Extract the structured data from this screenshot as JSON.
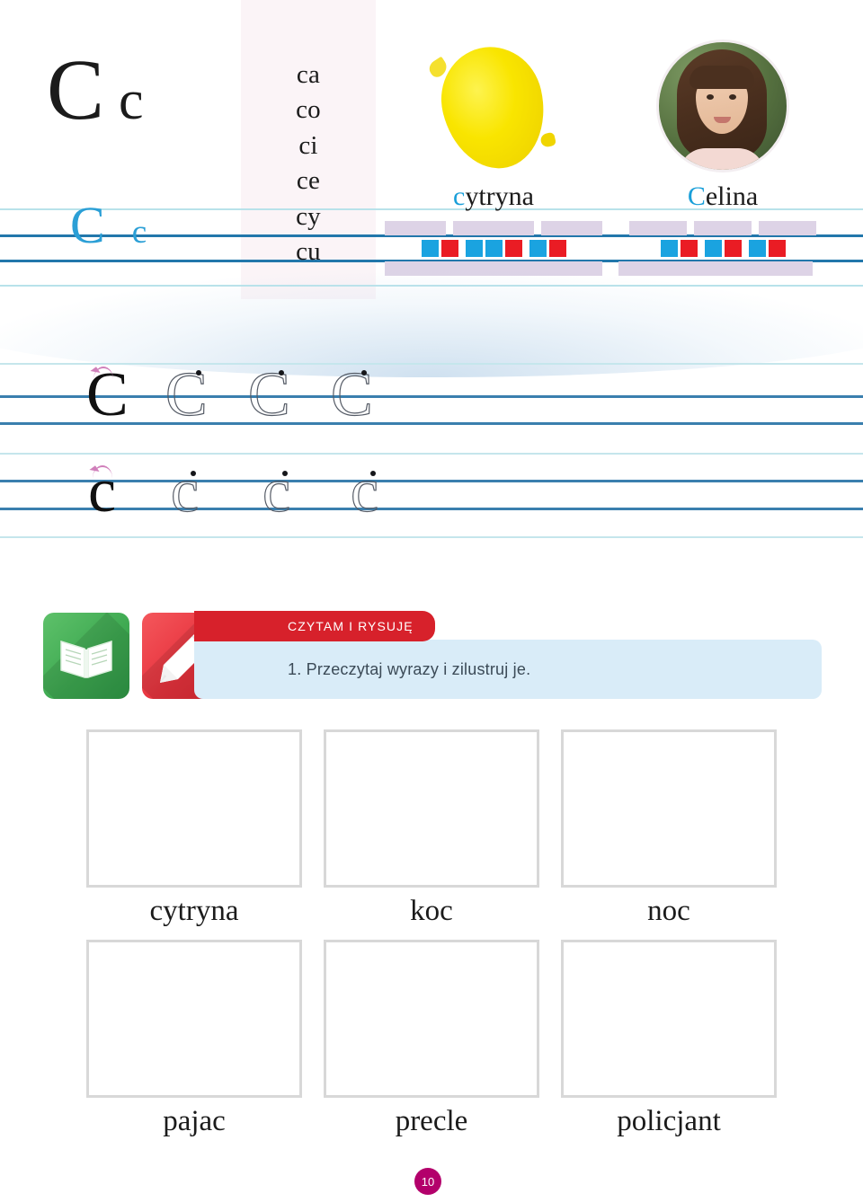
{
  "header": {
    "letter_upper": "C",
    "letter_lower": "c",
    "trace_upper": "C",
    "trace_lower": "c",
    "syllables": [
      "ca",
      "co",
      "ci",
      "ce",
      "cy",
      "cu"
    ],
    "words": [
      {
        "label_accent": "c",
        "label_rest": "ytryna",
        "picture": "lemon-illustration",
        "syllable_count": 3,
        "syllable_widths": [
          72,
          96,
          72
        ],
        "sounds": [
          [
            "blue",
            "red"
          ],
          [
            "blue",
            "blue",
            "red"
          ],
          [
            "blue",
            "red"
          ]
        ]
      },
      {
        "label_accent": "C",
        "label_rest": "elina",
        "picture": "girl-photo-avatar",
        "syllable_count": 3,
        "syllable_widths": [
          64,
          64,
          64
        ],
        "sounds": [
          [
            "blue",
            "red"
          ],
          [
            "blue",
            "red"
          ],
          [
            "blue",
            "red"
          ]
        ]
      }
    ]
  },
  "practice": {
    "row_upper": {
      "solid": "C",
      "dotted": [
        "C",
        "C",
        "C"
      ]
    },
    "row_lower": {
      "solid": "c",
      "dotted": [
        "c",
        "c",
        "c"
      ]
    }
  },
  "instruction": {
    "ribbon_label": "CZYTAM I RYSUJĘ",
    "task_text": "1. Przeczytaj wyrazy i zilustruj je.",
    "icons": [
      "open-book-icon",
      "pencil-icon"
    ]
  },
  "exercise": {
    "rows": [
      {
        "cells": [
          {
            "word": "cytryna"
          },
          {
            "word": "koc"
          },
          {
            "word": "noc"
          }
        ]
      },
      {
        "cells": [
          {
            "word": "pajac"
          },
          {
            "word": "precle"
          },
          {
            "word": "policjant"
          }
        ]
      }
    ]
  },
  "footer": {
    "page_number": "10"
  },
  "colors": {
    "accent_blue": "#1a9fd9",
    "rule_dark": "#3a7fae",
    "rule_light": "#c5e6ec",
    "ribbon_red": "#d7212b",
    "banner_blue": "#d9ecf8",
    "syllable_bar": "#ddd3e6",
    "sound_blue": "#1aa3e0",
    "sound_red": "#ea1c24",
    "page_badge": "#b3006b"
  }
}
